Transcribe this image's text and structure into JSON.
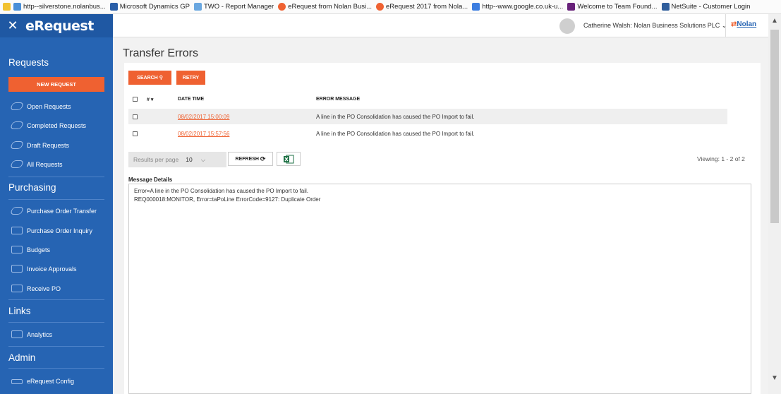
{
  "favorites": [
    {
      "label": "http--silverstone.nolanbus...",
      "color": "#4a8fd8"
    },
    {
      "label": "Microsoft Dynamics GP",
      "color": "#2a5fa8"
    },
    {
      "label": "TWO - Report Manager",
      "color": "#6aa7e0"
    },
    {
      "label": "eRequest from Nolan Busi...",
      "color": "#ef6131"
    },
    {
      "label": "eRequest 2017 from Nola...",
      "color": "#ef6131"
    },
    {
      "label": "http--www.google.co.uk-u...",
      "color": "#3b7de0"
    },
    {
      "label": "Welcome to Team Found...",
      "color": "#68217a"
    },
    {
      "label": "NetSuite - Customer Login",
      "color": "#2f5d9b"
    }
  ],
  "sidebar": {
    "close_glyph": "✕",
    "brand": "eRequest",
    "sections": {
      "requests": "Requests",
      "purchasing": "Purchasing",
      "links": "Links",
      "admin": "Admin"
    },
    "new_request": "NEW REQUEST",
    "request_items": [
      "Open Requests",
      "Completed Requests",
      "Draft Requests",
      "All Requests"
    ],
    "purchasing_items": [
      "Purchase Order Transfer",
      "Purchase Order Inquiry",
      "Budgets",
      "Invoice Approvals",
      "Receive PO"
    ],
    "links_items": [
      "Analytics"
    ],
    "admin_items": [
      "eRequest Config"
    ]
  },
  "header": {
    "user": "Catherine Walsh: Nolan Business Solutions PLC",
    "logo_text": "Nolan"
  },
  "page": {
    "title": "Transfer Errors",
    "search_label": "SEARCH",
    "retry_label": "RETRY",
    "columns": {
      "num": "#",
      "date_time": "DATE TIME",
      "error_message": "ERROR MESSAGE"
    },
    "rows": [
      {
        "date_time": "08/02/2017 15:00:09",
        "error_message": "A line in the PO Consolidation has caused the PO Import to fail."
      },
      {
        "date_time": "08/02/2017 15:57:56",
        "error_message": "A line in the PO Consolidation has caused the PO Import to fail."
      }
    ],
    "results_per_page_label": "Results per page",
    "results_per_page_value": "10",
    "refresh_label": "REFRESH",
    "viewing": "Viewing: 1 - 2 of 2",
    "message_details_label": "Message Details",
    "message_details": [
      "Error=A line in the PO Consolidation has caused the PO Import to fail.",
      "REQ000018:MONITOR, Error=taPoLine ErrorCode=9127: Duplicate Order"
    ]
  },
  "colors": {
    "accent": "#ef6131",
    "sidebar": "#2664b3"
  }
}
